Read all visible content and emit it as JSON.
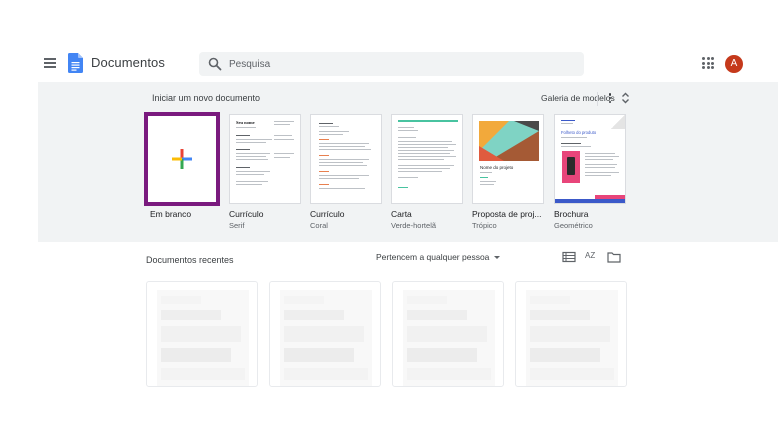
{
  "header": {
    "app_name": "Documentos",
    "search_placeholder": "Pesquisa",
    "avatar_initial": "A"
  },
  "templates": {
    "section_title": "Iniciar um novo documento",
    "gallery_label": "Galeria de modelos",
    "items": [
      {
        "name": "Em branco",
        "subtitle": ""
      },
      {
        "name": "Currículo",
        "subtitle": "Serif",
        "thumb_title": "Seu nome"
      },
      {
        "name": "Currículo",
        "subtitle": "Coral"
      },
      {
        "name": "Carta",
        "subtitle": "Verde-hortelã"
      },
      {
        "name": "Proposta de proj...",
        "subtitle": "Trópico",
        "thumb_title": "Nome do projeto"
      },
      {
        "name": "Brochura",
        "subtitle": "Geométrico",
        "thumb_title": "Folheto do produto"
      }
    ]
  },
  "recent": {
    "section_title": "Documentos recentes",
    "owner_filter": "Pertencem a qualquer pessoa",
    "sort_label": "AZ"
  },
  "colors": {
    "blank_border": "#7a1a7e",
    "avatar": "#c5391b",
    "docs_blue": "#4285f4",
    "panel_bg": "#f1f3f4"
  }
}
